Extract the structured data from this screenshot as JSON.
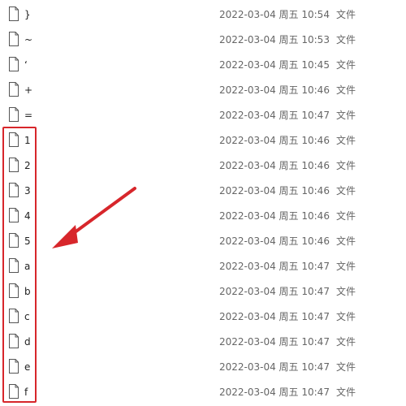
{
  "files": [
    {
      "name": "}",
      "modified": "2022-03-04 周五 10:54",
      "type": "文件"
    },
    {
      "name": "~",
      "modified": "2022-03-04 周五 10:53",
      "type": "文件"
    },
    {
      "name": "‘",
      "modified": "2022-03-04 周五 10:45",
      "type": "文件"
    },
    {
      "name": "+",
      "modified": "2022-03-04 周五 10:46",
      "type": "文件"
    },
    {
      "name": "=",
      "modified": "2022-03-04 周五 10:47",
      "type": "文件"
    },
    {
      "name": "1",
      "modified": "2022-03-04 周五 10:46",
      "type": "文件"
    },
    {
      "name": "2",
      "modified": "2022-03-04 周五 10:46",
      "type": "文件"
    },
    {
      "name": "3",
      "modified": "2022-03-04 周五 10:46",
      "type": "文件"
    },
    {
      "name": "4",
      "modified": "2022-03-04 周五 10:46",
      "type": "文件"
    },
    {
      "name": "5",
      "modified": "2022-03-04 周五 10:46",
      "type": "文件"
    },
    {
      "name": "a",
      "modified": "2022-03-04 周五 10:47",
      "type": "文件"
    },
    {
      "name": "b",
      "modified": "2022-03-04 周五 10:47",
      "type": "文件"
    },
    {
      "name": "c",
      "modified": "2022-03-04 周五 10:47",
      "type": "文件"
    },
    {
      "name": "d",
      "modified": "2022-03-04 周五 10:47",
      "type": "文件"
    },
    {
      "name": "e",
      "modified": "2022-03-04 周五 10:47",
      "type": "文件"
    },
    {
      "name": "f",
      "modified": "2022-03-04 周五 10:47",
      "type": "文件"
    }
  ],
  "icons": {
    "file": "file-icon"
  },
  "annotation": {
    "color": "#d7262b"
  }
}
